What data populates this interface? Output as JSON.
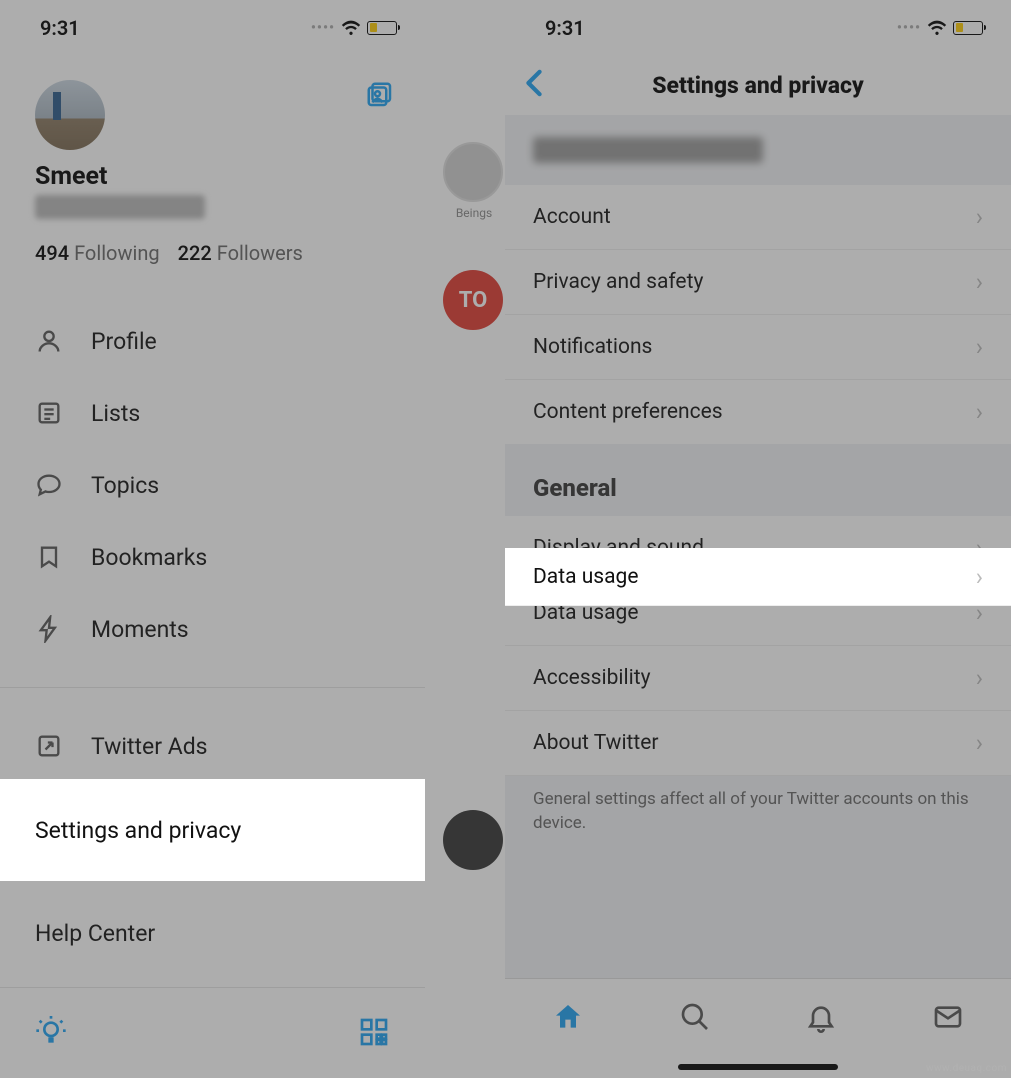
{
  "status": {
    "time": "9:31"
  },
  "left": {
    "display_name": "Smeet",
    "following_count": "494",
    "following_label": "Following",
    "followers_count": "222",
    "followers_label": "Followers",
    "menu": {
      "profile": "Profile",
      "lists": "Lists",
      "topics": "Topics",
      "bookmarks": "Bookmarks",
      "moments": "Moments",
      "twitter_ads": "Twitter Ads",
      "settings_privacy": "Settings and privacy",
      "help_center": "Help Center"
    },
    "peek_label": "Beings"
  },
  "right": {
    "title": "Settings and privacy",
    "rows": {
      "account": "Account",
      "privacy_safety": "Privacy and safety",
      "notifications": "Notifications",
      "content_prefs": "Content preferences",
      "general_header": "General",
      "display_sound": "Display and sound",
      "data_usage": "Data usage",
      "accessibility": "Accessibility",
      "about_twitter": "About Twitter",
      "footer_text": "General settings affect all of your Twitter accounts on this device."
    }
  },
  "watermark": "www.deuaq.com"
}
